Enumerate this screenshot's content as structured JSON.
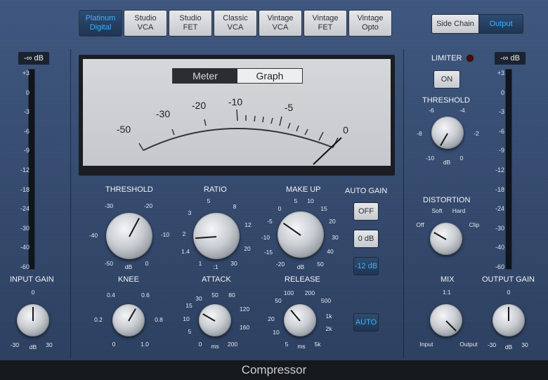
{
  "models": [
    {
      "label": "Platinum\nDigital",
      "active": true
    },
    {
      "label": "Studio\nVCA",
      "active": false
    },
    {
      "label": "Studio\nFET",
      "active": false
    },
    {
      "label": "Classic\nVCA",
      "active": false
    },
    {
      "label": "Vintage\nVCA",
      "active": false
    },
    {
      "label": "Vintage\nFET",
      "active": false
    },
    {
      "label": "Vintage\nOpto",
      "active": false
    }
  ],
  "routing": {
    "side_chain": "Side Chain",
    "output": "Output"
  },
  "input_meter": {
    "readout": "-∞ dB",
    "scale": [
      "+3",
      "0",
      "-3",
      "-6",
      "-9",
      "-12",
      "-18",
      "-24",
      "-30",
      "-40",
      "-60"
    ]
  },
  "output_meter": {
    "readout": "-∞ dB",
    "scale": [
      "+3",
      "0",
      "-3",
      "-6",
      "-9",
      "-12",
      "-18",
      "-24",
      "-30",
      "-40",
      "-60"
    ]
  },
  "vu": {
    "meter_label": "Meter",
    "graph_label": "Graph",
    "scale": [
      "-50",
      "-30",
      "-20",
      "-10",
      "-5",
      "0"
    ]
  },
  "limiter": {
    "label": "LIMITER",
    "button": "ON",
    "threshold_label": "THRESHOLD",
    "threshold_scale": [
      "-6",
      "-4",
      "-8",
      "-2",
      "-10",
      "0"
    ],
    "threshold_unit": "dB"
  },
  "threshold": {
    "label": "THRESHOLD",
    "scale": [
      "-30",
      "-20",
      "-40",
      "-10",
      "-50",
      "0"
    ],
    "unit": "dB"
  },
  "ratio": {
    "label": "RATIO",
    "scale": [
      "5",
      "8",
      "3",
      "12",
      "2",
      "20",
      "1.4",
      "30",
      "1"
    ],
    "unit": ":1"
  },
  "makeup": {
    "label": "MAKE UP",
    "scale": [
      "5",
      "10",
      "0",
      "15",
      "-5",
      "20",
      "-10",
      "30",
      "-15",
      "40",
      "-20",
      "50"
    ],
    "unit": "dB"
  },
  "auto_gain": {
    "label": "AUTO GAIN",
    "off": "OFF",
    "zero": "0 dB",
    "minus12": "-12 dB"
  },
  "distortion": {
    "label": "DISTORTION",
    "soft": "Soft",
    "hard": "Hard",
    "off": "Off",
    "clip": "Clip"
  },
  "input_gain": {
    "label": "INPUT GAIN",
    "top": "0",
    "left": "-30",
    "right": "30",
    "unit": "dB"
  },
  "knee": {
    "label": "KNEE",
    "scale": [
      "0.4",
      "0.6",
      "0.2",
      "0.8",
      "0",
      "1.0"
    ]
  },
  "attack": {
    "label": "ATTACK",
    "scale": [
      "50",
      "80",
      "30",
      "120",
      "15",
      "10",
      "160",
      "5",
      "0",
      "200"
    ],
    "unit": "ms"
  },
  "release": {
    "label": "RELEASE",
    "scale": [
      "100",
      "200",
      "50",
      "500",
      "1k",
      "20",
      "10",
      "2k",
      "5",
      "5k"
    ],
    "unit": "ms",
    "auto": "AUTO"
  },
  "mix": {
    "label": "MIX",
    "top": "1:1",
    "left": "Input",
    "right": "Output"
  },
  "output_gain": {
    "label": "OUTPUT GAIN",
    "top": "0",
    "left": "-30",
    "right": "30",
    "unit": "dB"
  },
  "footer": "Compressor"
}
